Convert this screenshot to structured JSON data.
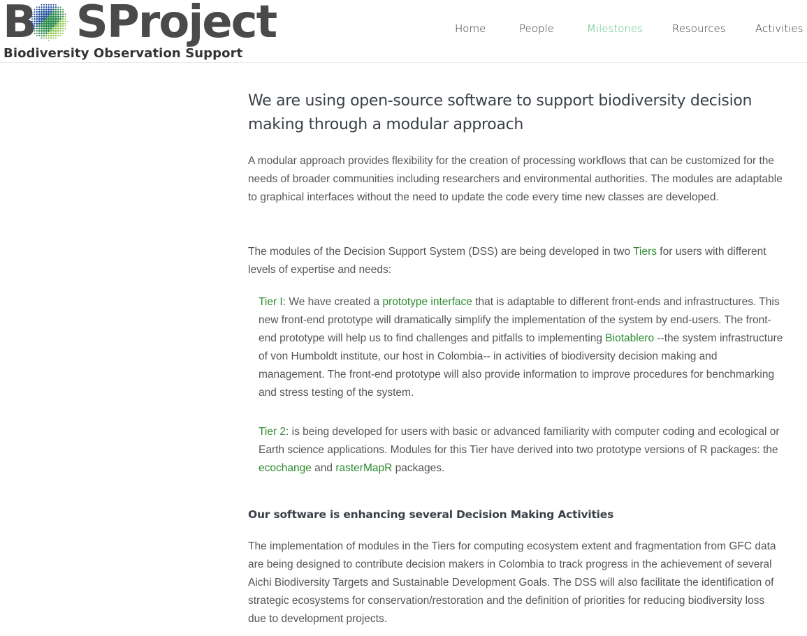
{
  "brand": {
    "logo_prefix": "B",
    "logo_suffix": "SProject",
    "tagline": "Biodiversity Observation Support",
    "globe_colors": [
      "#1f4e9a",
      "#2a8a4a",
      "#8bc34a"
    ]
  },
  "nav": {
    "items": [
      {
        "label": "Home",
        "active": false
      },
      {
        "label": "People",
        "active": false
      },
      {
        "label": "Milestones",
        "active": true
      },
      {
        "label": "Resources",
        "active": false
      },
      {
        "label": "Activities",
        "active": false
      }
    ],
    "active_color": "#4fbf80"
  },
  "main": {
    "heading": "We are using open-source software to support biodiversity decision making through a modular approach",
    "intro": "A modular approach provides flexibility for the creation of processing workflows  that can be customized for the needs of broader communities including researchers and environmental authorities. The modules are adaptable to graphical interfaces without the need to update the code every time new classes are developed.",
    "tiers_intro": {
      "before": "The modules of the Decision Support System (DSS) are being developed in two ",
      "link": "Tiers",
      "after": " for users with different levels of expertise and needs:"
    },
    "tier1": {
      "link": "Tier I",
      "t1": ": We have created a ",
      "link2": "prototype interface",
      "t2": " that is adaptable to different front-ends and infrastructures. This new front-end prototype will dramatically simplify the implementation of the system by end-users. The front-end prototype will help us to find challenges and pitfalls to implementing ",
      "link3": "Biotablero",
      "t3": " --the system infrastructure of von Humboldt institute, our host in Colombia-- in activities of biodiversity decision making and management. The front-end prototype will also provide information to improve procedures for benchmarking and stress testing of the system."
    },
    "tier2": {
      "link": "Tier 2",
      "t1": ": is being developed for users with basic or advanced familiarity with computer coding and ecological or Earth science applications. Modules for this Tier have derived into two prototype versions of R packages: the ",
      "link2": "ecochange",
      "t2": " and ",
      "link3": "rasterMapR",
      "t3": " packages."
    },
    "subheading": "Our software is enhancing several Decision Making Activities",
    "closing": "The implementation of modules in the Tiers for computing ecosystem extent and fragmentation from GFC data are being designed to contribute decision makers in Colombia to track progress in the achievement of several Aichi Biodiversity Targets and Sustainable Development Goals. The DSS will also facilitate the identification of strategic ecosystems for conservation/restoration and the definition of priorities for reducing biodiversity loss due to development projects."
  }
}
